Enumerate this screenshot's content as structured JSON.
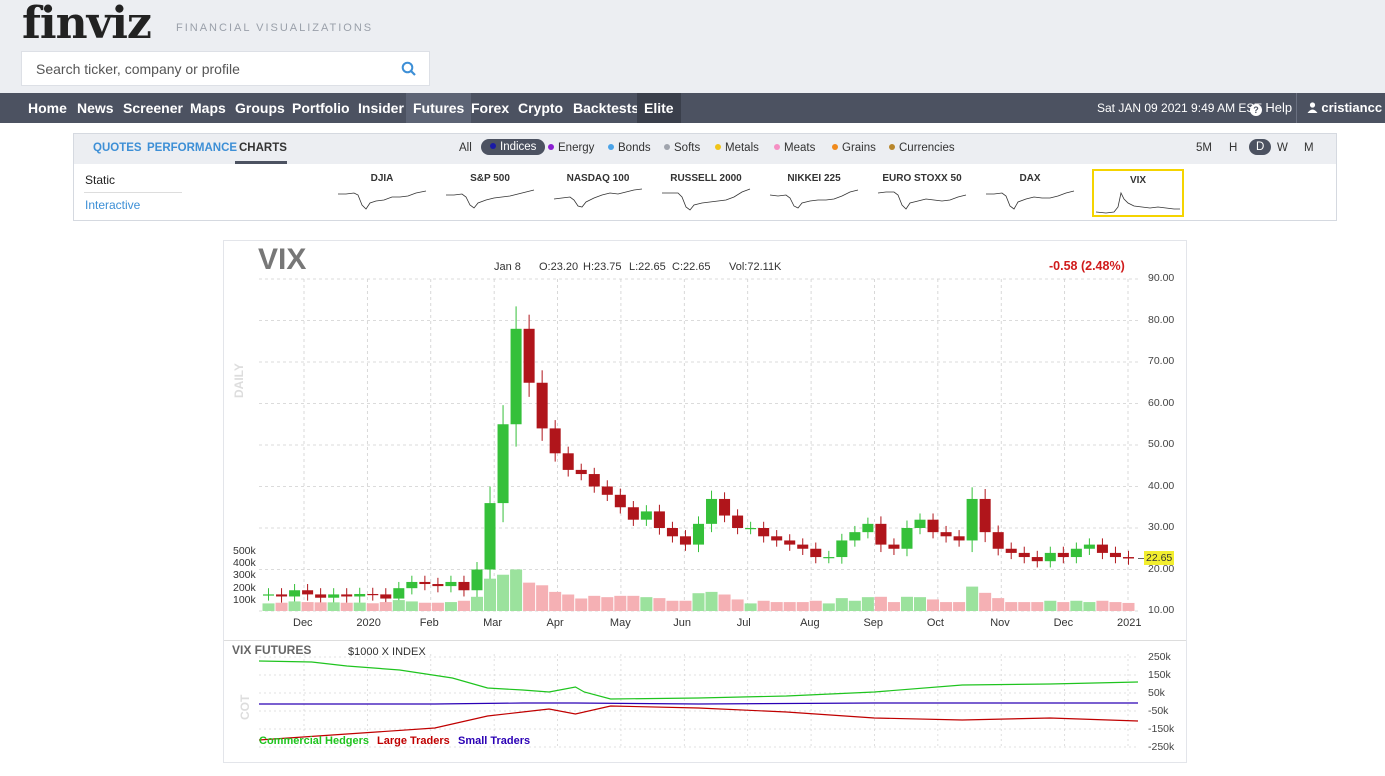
{
  "brand": {
    "logo": "finviz",
    "tagline": "FINANCIAL VISUALIZATIONS"
  },
  "search": {
    "placeholder": "Search ticker, company or profile"
  },
  "nav": {
    "items": [
      "Home",
      "News",
      "Screener",
      "Maps",
      "Groups",
      "Portfolio",
      "Insider",
      "Futures",
      "Forex",
      "Crypto",
      "Backtests",
      "Elite"
    ],
    "active": "Futures",
    "datetime": "Sat JAN 09 2021 9:49 AM EST",
    "help": "Help",
    "user": "cristiancc"
  },
  "panel": {
    "tabs": [
      "QUOTES",
      "PERFORMANCE",
      "CHARTS"
    ],
    "active_tab": "CHARTS",
    "categories": [
      {
        "label": "All",
        "color": ""
      },
      {
        "label": "Indices",
        "color": "#1a1aa6"
      },
      {
        "label": "Energy",
        "color": "#8b1fd1"
      },
      {
        "label": "Bonds",
        "color": "#4aa3e8"
      },
      {
        "label": "Softs",
        "color": "#a0a4ad"
      },
      {
        "label": "Metals",
        "color": "#f0c419"
      },
      {
        "label": "Meats",
        "color": "#f58fc3"
      },
      {
        "label": "Grains",
        "color": "#f08a1c"
      },
      {
        "label": "Currencies",
        "color": "#b8862b"
      }
    ],
    "active_category": "Indices",
    "timeframes": [
      "5M",
      "H",
      "D",
      "W",
      "M"
    ],
    "active_timeframe": "D",
    "side": [
      "Static",
      "Interactive"
    ],
    "minis": [
      "DJIA",
      "S&P 500",
      "NASDAQ 100",
      "RUSSELL 2000",
      "NIKKEI 225",
      "EURO STOXX 50",
      "DAX",
      "VIX"
    ],
    "selected_mini": "VIX"
  },
  "chart": {
    "ticker": "VIX",
    "date": "Jan 8",
    "open": "O:23.20",
    "high": "H:23.75",
    "low": "L:22.65",
    "close": "C:22.65",
    "volume": "Vol:72.11K",
    "change": "-0.58 (2.48%)",
    "last_price": "22.65",
    "period_label": "DAILY",
    "volume_labels": [
      "500k",
      "400k",
      "300k",
      "200k",
      "100k"
    ],
    "colors": {
      "up": "#35c03a",
      "down": "#b0151b",
      "vol_up": "#9be29d",
      "vol_down": "#f5b0b4",
      "highlight": "#f2ee2f"
    }
  },
  "futures": {
    "title": "VIX FUTURES",
    "subtitle": "$1000 X INDEX",
    "cot_label": "COT",
    "y_labels": [
      "250k",
      "150k",
      "50k",
      "-50k",
      "-150k",
      "-250k"
    ],
    "legend": [
      {
        "name": "Commercial Hedgers",
        "color": "#1fc41f"
      },
      {
        "name": "Large Traders",
        "color": "#c00000"
      },
      {
        "name": "Small Traders",
        "color": "#2a00b5"
      }
    ]
  },
  "chart_data": {
    "type": "line",
    "title": "VIX",
    "x": [
      "Dec",
      "2020",
      "Feb",
      "Mar",
      "Apr",
      "May",
      "Jun",
      "Jul",
      "Aug",
      "Sep",
      "Oct",
      "Nov",
      "Dec",
      "2021"
    ],
    "y_ticks": [
      10,
      20,
      30,
      40,
      50,
      60,
      70,
      80,
      90
    ],
    "ylim": [
      10,
      90
    ],
    "grid": true,
    "series": [
      {
        "values": [
          14,
          13.5,
          15,
          14,
          13.2,
          14,
          13.5,
          14.1,
          14,
          13,
          15.5,
          17,
          16.5,
          16,
          17,
          15,
          20,
          36,
          55,
          78,
          65,
          54,
          48,
          44,
          43,
          40,
          38,
          35,
          32,
          34,
          30,
          28,
          26,
          31,
          37,
          33,
          30,
          30,
          28,
          27,
          26,
          25,
          23,
          23,
          27,
          29,
          31,
          26,
          25,
          30,
          32,
          29,
          28,
          27,
          37,
          29,
          25,
          24,
          23,
          22,
          24,
          23,
          25,
          26,
          24,
          23,
          22.65
        ]
      }
    ]
  }
}
